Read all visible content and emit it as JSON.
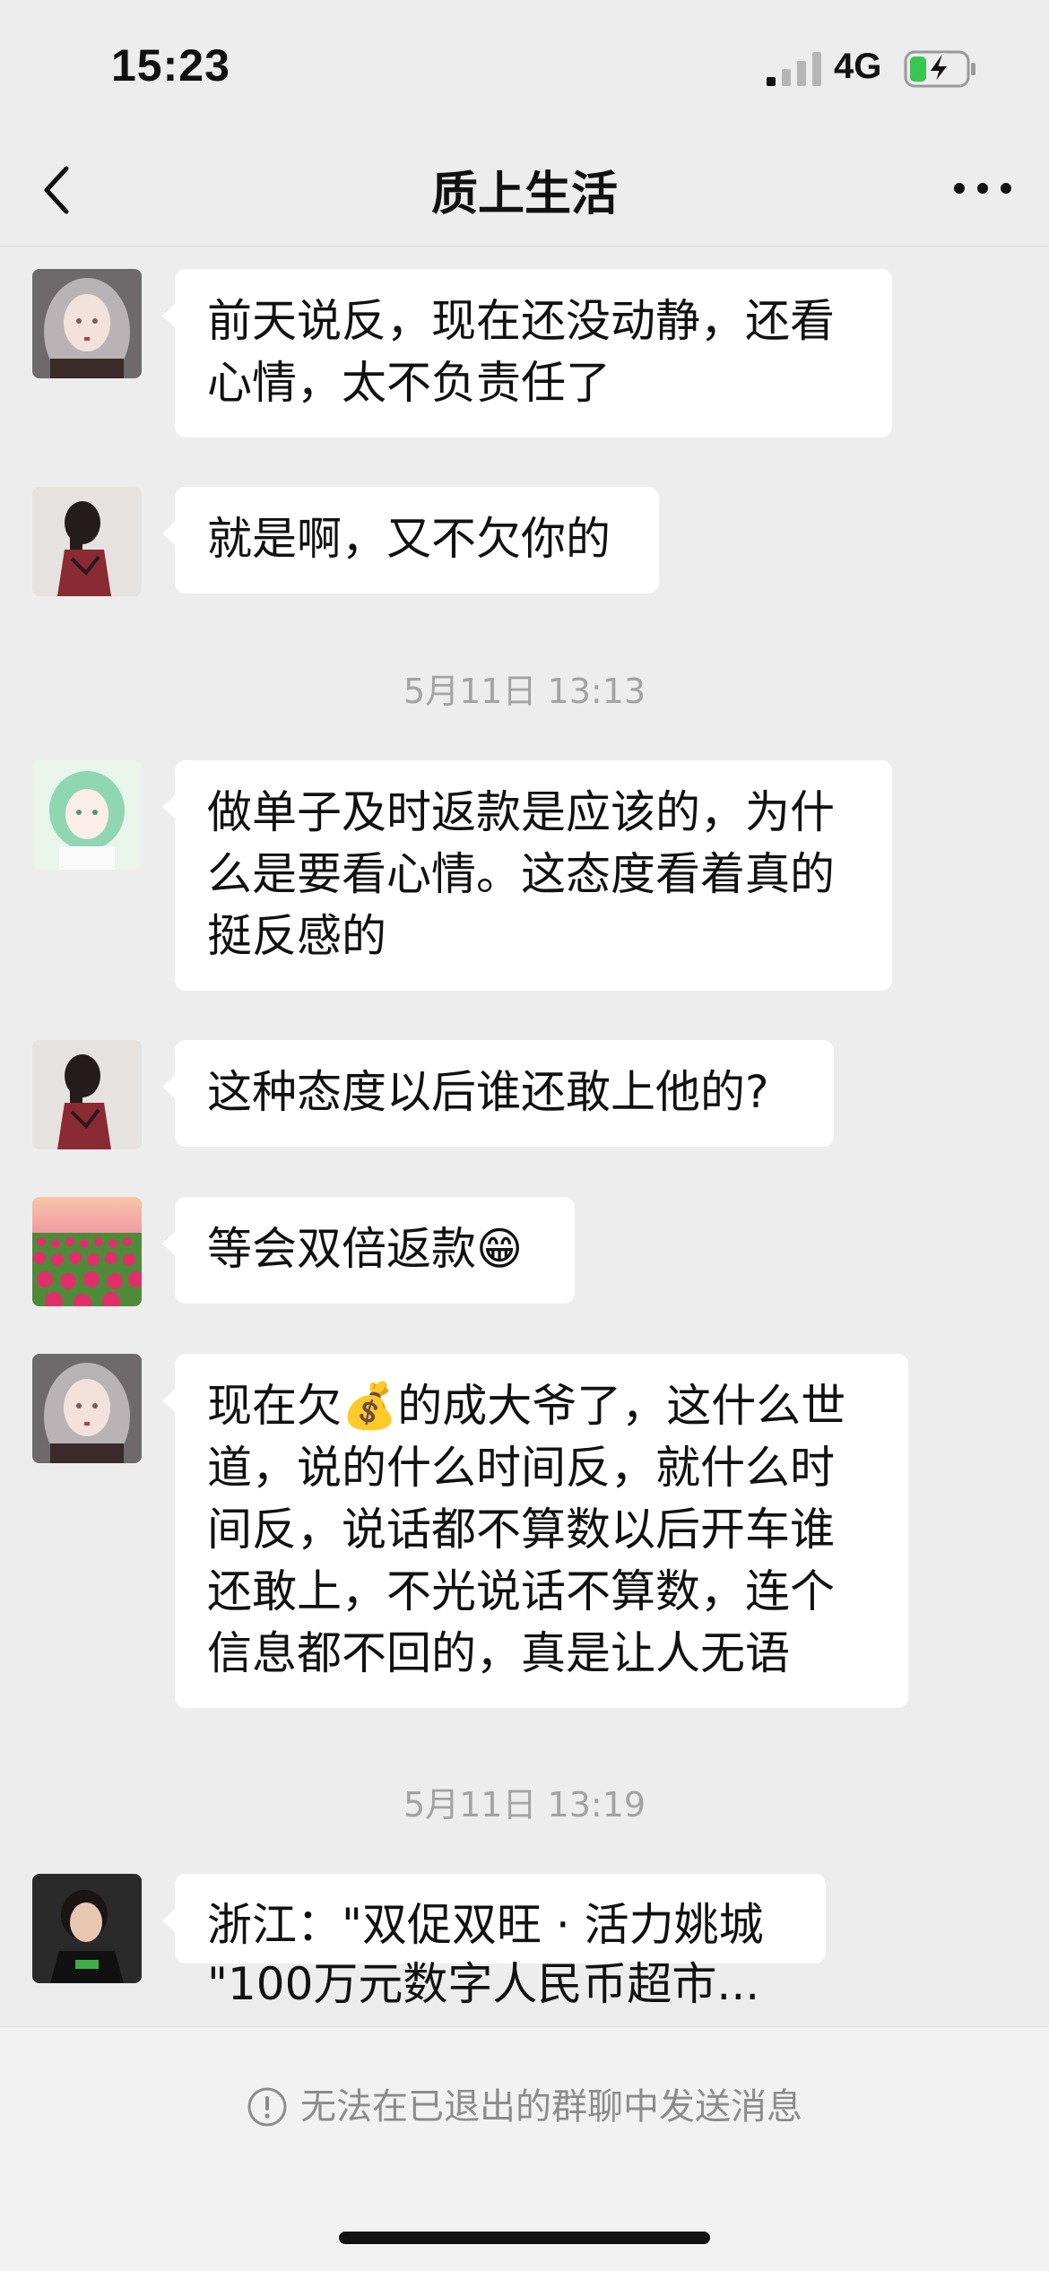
{
  "status_bar": {
    "time": "15:23",
    "network": "4G",
    "battery_icon": "battery-charging-icon"
  },
  "nav": {
    "title": "质上生活",
    "back_icon": "chevron-left-icon",
    "more_icon": "more-dots-icon"
  },
  "messages": [
    {
      "avatar": "avatar-gray-hair-girl",
      "text": "前天说反，现在还没动静，还看心情，太不负责任了"
    },
    {
      "avatar": "avatar-dark-hair-girl",
      "text": "就是啊，又不欠你的"
    },
    {
      "timestamp": "5月11日 13:13"
    },
    {
      "avatar": "avatar-green-hair-anime",
      "text": "做单子及时返款是应该的，为什么是要看心情。这态度看着真的挺反感的"
    },
    {
      "avatar": "avatar-dark-hair-girl",
      "text": "这种态度以后谁还敢上他的?"
    },
    {
      "avatar": "avatar-tulip-field",
      "text": "等会双倍返款😁"
    },
    {
      "avatar": "avatar-gray-hair-girl",
      "text": "现在欠💰的成大爷了，这什么世道，说的什么时间反，就什么时间反，说话都不算数以后开车谁还敢上，不光说话不算数，连个信息都不回的，真是让人无语"
    },
    {
      "timestamp": "5月11日 13:19"
    },
    {
      "avatar": "avatar-young-man",
      "text_line1": "浙江：\"双促双旺 · 活力姚城",
      "text_line2": "\"100万元数字人民币超市..."
    }
  ],
  "footer": {
    "notice": "无法在已退出的群聊中发送消息",
    "notice_icon": "exclamation-circle-icon"
  }
}
